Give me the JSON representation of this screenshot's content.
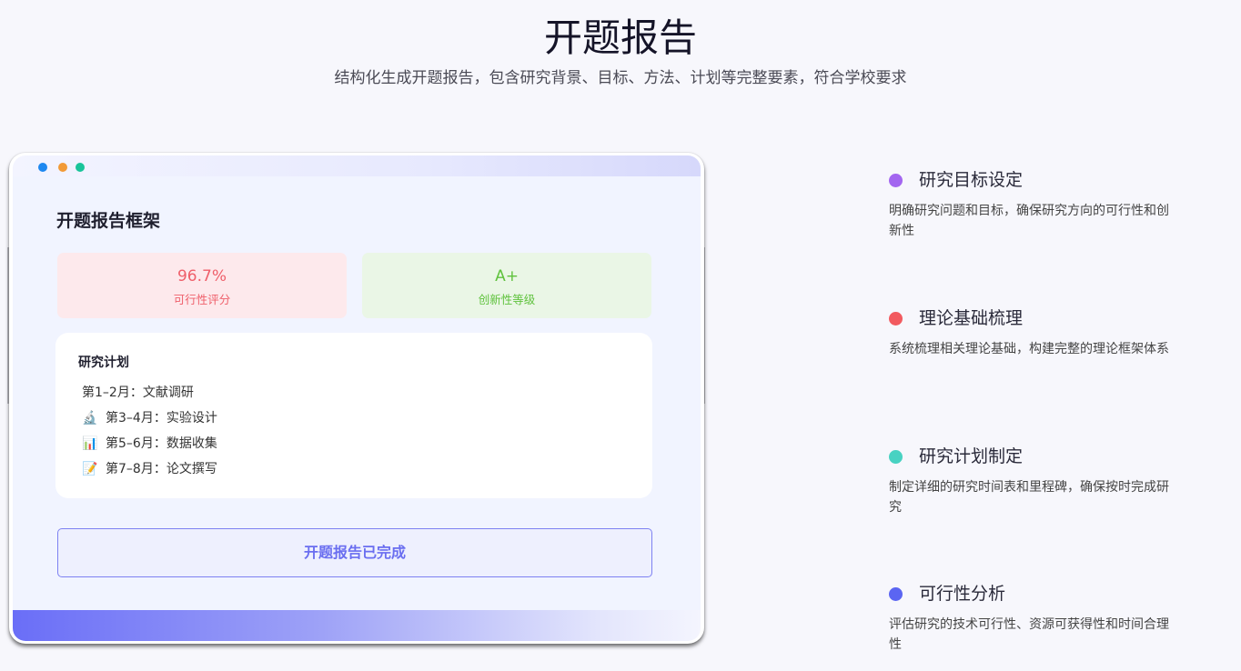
{
  "header": {
    "title": "开题报告",
    "subtitle": "结构化生成开题报告，包含研究背景、目标、方法、计划等完整要素，符合学校要求"
  },
  "mockup": {
    "frame_title": "开题报告框架",
    "stats": [
      {
        "value": "96.7%",
        "label": "可行性评分",
        "color": "#ef5f6a"
      },
      {
        "value": "A+",
        "label": "创新性等级",
        "color": "#5fc23d"
      }
    ],
    "plan": {
      "title": "研究计划",
      "items": [
        {
          "icon": "",
          "text": "第1–2月：文献调研"
        },
        {
          "icon": "microscope-icon",
          "glyph": "🔬",
          "text": "第3–4月：实验设计"
        },
        {
          "icon": "bar-chart-icon",
          "glyph": "📊",
          "text": "第5–6月：数据收集"
        },
        {
          "icon": "memo-icon",
          "glyph": "📝",
          "text": "第7–8月：论文撰写"
        }
      ]
    },
    "status_button": "开题报告已完成",
    "window_dots": [
      "#1e88f0",
      "#f29a37",
      "#19c49a"
    ]
  },
  "features": [
    {
      "title": "研究目标设定",
      "desc": "明确研究问题和目标，确保研究方向的可行性和创新性",
      "color": "#a366f0"
    },
    {
      "title": "理论基础梳理",
      "desc": "系统梳理相关理论基础，构建完整的理论框架体系",
      "color": "#f25a5f"
    },
    {
      "title": "研究计划制定",
      "desc": "制定详细的研究时间表和里程碑，确保按时完成研究",
      "color": "#48d2c2"
    },
    {
      "title": "可行性分析",
      "desc": "评估研究的技术可行性、资源可获得性和时间合理性",
      "color": "#5b65f2"
    }
  ]
}
